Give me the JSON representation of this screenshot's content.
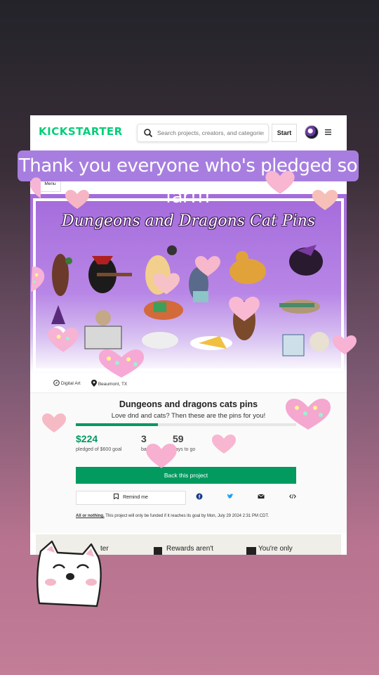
{
  "header": {
    "logo_text": "KICKSTARTER",
    "search_placeholder": "Search projects, creators, and categories",
    "start_label": "Start",
    "menu_label": "Menu"
  },
  "overlay": {
    "banner_text": "Thank you everyone who's pledged so far!!!"
  },
  "hero": {
    "title": "Dungeons and Dragons Cat Pins"
  },
  "meta": {
    "category": "Digital Art",
    "location": "Beaumont, TX"
  },
  "project": {
    "title": "Dungeons and dragons cats pins",
    "blurb": "Love dnd and cats? Then these are the pins for you!",
    "pledged": "$224",
    "pledged_label": "pledged of $600 goal",
    "progress_fraction": 0.373,
    "backers": "3",
    "backers_label": "backers",
    "days": "59",
    "days_label": "days to go",
    "back_button": "Back this project",
    "remind_button": "Remind me",
    "funding_note_link": "All or nothing.",
    "funding_note_text": "This project will only be funded if it reaches its goal by Mon, July 29 2024 2:31 PM CDT."
  },
  "bottom_strip": {
    "item1": "ter",
    "item2": "Rewards aren't",
    "item3": "You're only"
  },
  "colors": {
    "kickstarter_green": "#05ce78",
    "back_button": "#029a5f",
    "banner": "#a77ee0"
  }
}
